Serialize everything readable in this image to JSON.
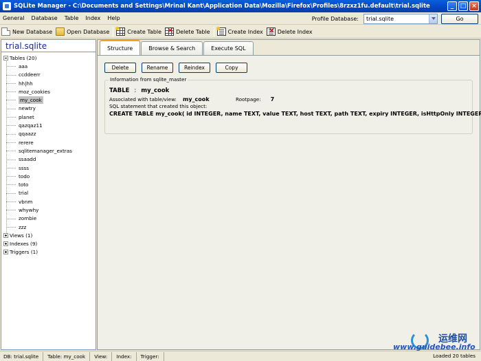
{
  "window": {
    "title": "SQLite Manager - C:\\Documents and Settings\\Mrinal Kant\\Application Data\\Mozilla\\Firefox\\Profiles\\8rzxz1fu.default\\trial.sqlite",
    "controls": [
      "_",
      "□",
      "×"
    ]
  },
  "menubar": {
    "items": [
      "General",
      "Database",
      "Table",
      "Index",
      "Help"
    ],
    "profile_label": "Profile Database:",
    "profile_value": "trial.sqlite",
    "go_label": "Go"
  },
  "toolbar": {
    "buttons": [
      {
        "label": "New Database",
        "icon": "new-document-icon"
      },
      {
        "label": "Open Database",
        "icon": "open-folder-icon"
      },
      {
        "label": "Create Table",
        "icon": "create-table-icon"
      },
      {
        "label": "Delete Table",
        "icon": "delete-table-icon"
      },
      {
        "label": "Create Index",
        "icon": "create-index-icon"
      },
      {
        "label": "Delete Index",
        "icon": "delete-index-icon"
      }
    ]
  },
  "sidebar": {
    "db_name": "trial.sqlite",
    "tables_label": "Tables (20)",
    "tables": [
      "aaa",
      "ccddeerr",
      "hh|hh",
      "moz_cookies",
      "my_cook",
      "newtry",
      "planet",
      "qazqaz11",
      "qqaazz",
      "rerere",
      "sqlitemanager_extras",
      "ssaadd",
      "ssss",
      "todo",
      "toto",
      "trial",
      "vbnm",
      "whywhy",
      "zombie",
      "zzz"
    ],
    "selected": "my_cook",
    "views_label": "Views (1)",
    "indexes_label": "Indexes (9)",
    "triggers_label": "Triggers (1)"
  },
  "tabs": [
    "Structure",
    "Browse & Search",
    "Execute SQL"
  ],
  "active_tab": "Structure",
  "actions": [
    "Delete",
    "Rename",
    "Reindex",
    "Copy"
  ],
  "info": {
    "legend": "Information from sqlite_master",
    "type": "TABLE",
    "separator": ":",
    "name": "my_cook",
    "assoc_label": "Associated with table/view:",
    "assoc_value": "my_cook",
    "rootpage_label": "Rootpage:",
    "rootpage_value": "7",
    "sql_label": "SQL statement that created this object:",
    "sql": "CREATE TABLE my_cook( id INTEGER, name TEXT, value TEXT, host TEXT, path TEXT, expiry INTEGER, isHttpOnly INTEGER )"
  },
  "statusbar": {
    "db": "DB: trial.sqlite",
    "table": "Table: my_cook",
    "view": "View:",
    "index": "Index:",
    "trigger": "Trigger:",
    "right": "Loaded 20 tables"
  },
  "watermark": {
    "cn": "运维网",
    "url": "www.guidebee.info"
  }
}
